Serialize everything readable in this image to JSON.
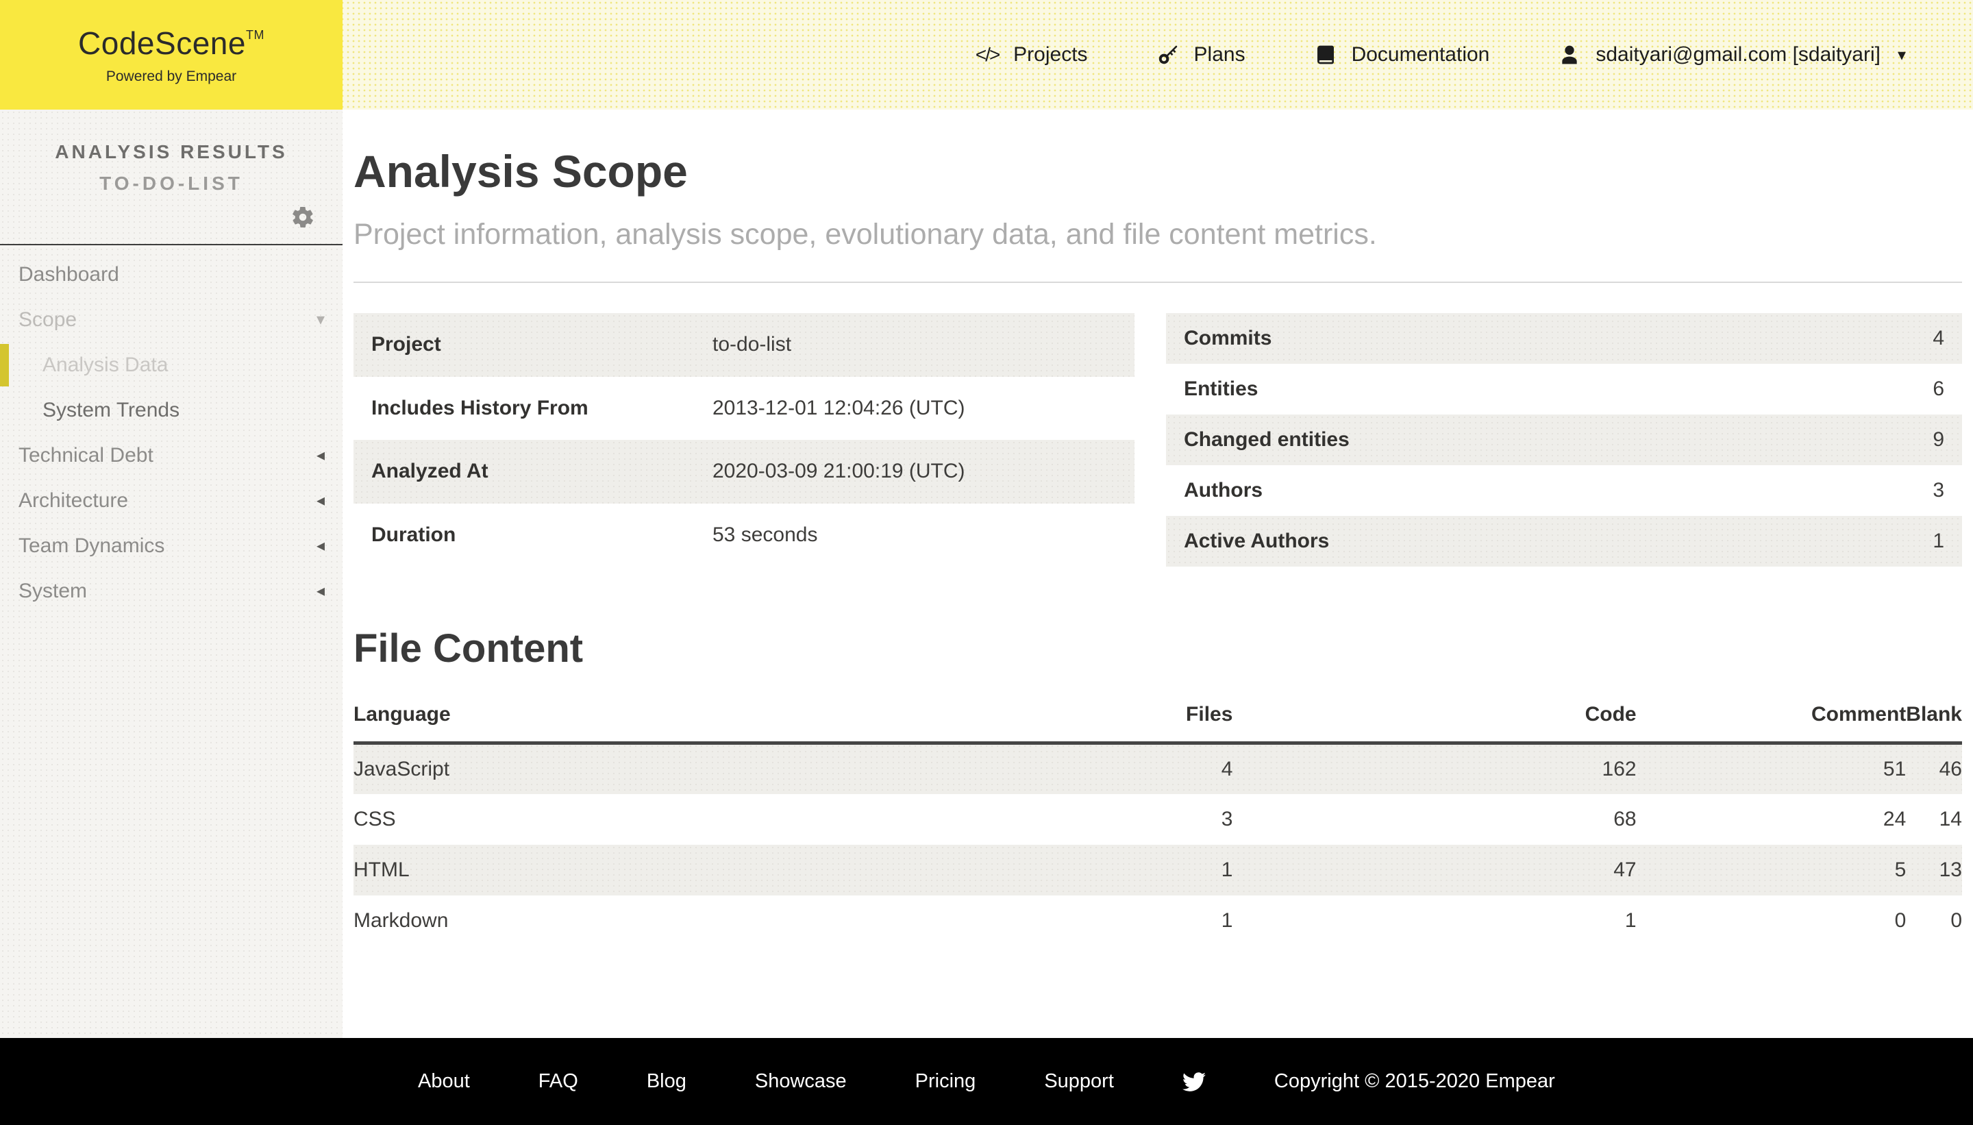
{
  "colors": {
    "brand_yellow": "#F9E840",
    "header_cream": "#FBF9E2",
    "sidebar_gray": "#F5F4F1",
    "row_stripe": "#EFEEEA",
    "active_bar_yellow": "#D4C52F",
    "footer_black": "#000000"
  },
  "header": {
    "logo_title": "CodeScene",
    "logo_tm": "TM",
    "logo_tagline": "Powered by Empear",
    "nav": [
      {
        "label": "Projects",
        "icon": "code-icon",
        "code_glyph": "</>"
      },
      {
        "label": "Plans",
        "icon": "key-icon"
      },
      {
        "label": "Documentation",
        "icon": "book-icon"
      },
      {
        "label": "sdaityari@gmail.com [sdaityari]",
        "icon": "user-icon",
        "caret_glyph": "▾"
      }
    ]
  },
  "sidebar": {
    "section_title": "ANALYSIS RESULTS",
    "project_name": "TO-DO-LIST",
    "gear_icon": "gear-icon",
    "items": [
      {
        "label": "Dashboard"
      },
      {
        "label": "Scope",
        "caret_glyph": "▾"
      },
      {
        "label": "Analysis Data",
        "active": true
      },
      {
        "label": "System Trends"
      },
      {
        "label": "Technical Debt",
        "caret_glyph": "◂"
      },
      {
        "label": "Architecture",
        "caret_glyph": "◂"
      },
      {
        "label": "Team Dynamics",
        "caret_glyph": "◂"
      },
      {
        "label": "System",
        "caret_glyph": "◂"
      }
    ]
  },
  "main": {
    "title": "Analysis Scope",
    "subtitle": "Project information, analysis scope, evolutionary data, and file content metrics.",
    "project_table": {
      "rows": [
        {
          "label": "Project",
          "value": "to-do-list"
        },
        {
          "label": "Includes History From",
          "value": "2013-12-01 12:04:26 (UTC)"
        },
        {
          "label": "Analyzed At",
          "value": "2020-03-09 21:00:19 (UTC)"
        },
        {
          "label": "Duration",
          "value": "53 seconds"
        }
      ]
    },
    "stats_table": {
      "rows": [
        {
          "label": "Commits",
          "value": "4"
        },
        {
          "label": "Entities",
          "value": "6"
        },
        {
          "label": "Changed entities",
          "value": "9"
        },
        {
          "label": "Authors",
          "value": "3"
        },
        {
          "label": "Active Authors",
          "value": "1"
        }
      ]
    },
    "file_content": {
      "title": "File Content",
      "columns": [
        "Language",
        "Files",
        "Code",
        "Comment",
        "Blank"
      ],
      "rows": [
        {
          "language": "JavaScript",
          "files": "4",
          "code": "162",
          "comment": "51",
          "blank": "46"
        },
        {
          "language": "CSS",
          "files": "3",
          "code": "68",
          "comment": "24",
          "blank": "14"
        },
        {
          "language": "HTML",
          "files": "1",
          "code": "47",
          "comment": "5",
          "blank": "13"
        },
        {
          "language": "Markdown",
          "files": "1",
          "code": "1",
          "comment": "0",
          "blank": "0"
        }
      ]
    }
  },
  "footer": {
    "links": [
      "About",
      "FAQ",
      "Blog",
      "Showcase",
      "Pricing",
      "Support"
    ],
    "twitter_icon": "twitter-icon",
    "copyright": "Copyright © 2015-2020 Empear"
  }
}
